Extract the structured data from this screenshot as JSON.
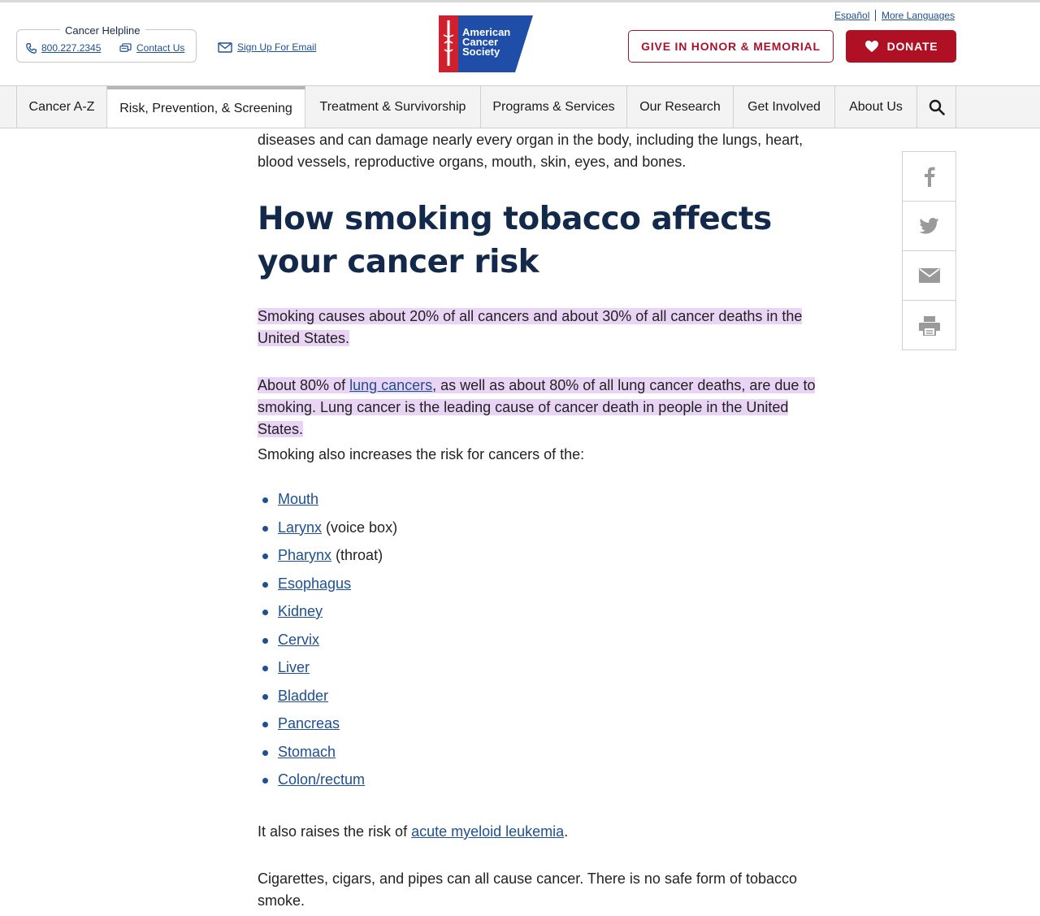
{
  "header": {
    "helpline_title": "Cancer Helpline",
    "phone": "800.227.2345",
    "contact": "Contact Us",
    "signup": "Sign Up For Email",
    "logo_lines": [
      "American",
      "Cancer",
      "Society"
    ],
    "lang_es": "Español",
    "lang_more": "More Languages",
    "honor_button": "GIVE IN HONOR & MEMORIAL",
    "donate_button": "DONATE"
  },
  "nav": {
    "items": [
      {
        "label": "Cancer A-Z"
      },
      {
        "label": "Risk, Prevention, & Screening"
      },
      {
        "label": "Treatment & Survivorship"
      },
      {
        "label": "Programs & Services"
      },
      {
        "label": "Our Research"
      },
      {
        "label": "Get Involved"
      },
      {
        "label": "About Us"
      }
    ],
    "active_index": 1
  },
  "article": {
    "intro": "diseases and can damage nearly every organ in the body, including the lungs, heart, blood vessels, reproductive organs, mouth, skin, eyes, and bones.",
    "heading": "How smoking tobacco affects your cancer risk",
    "p1": "Smoking causes about 20% of all cancers and about 30% of all cancer deaths in the United States.",
    "p2_pre": "About 80% of ",
    "p2_link": "lung cancers",
    "p2_post": ", as well as about 80% of all lung cancer deaths, are due to smoking. Lung cancer is the leading cause of cancer death in people in the United States.",
    "p3": "Smoking also increases the risk for cancers of the:",
    "list": [
      {
        "link": "Mouth",
        "suffix": ""
      },
      {
        "link": "Larynx",
        "suffix": " (voice box)"
      },
      {
        "link": "Pharynx",
        "suffix": " (throat)"
      },
      {
        "link": "Esophagus",
        "suffix": ""
      },
      {
        "link": "Kidney",
        "suffix": ""
      },
      {
        "link": "Cervix",
        "suffix": ""
      },
      {
        "link": "Liver",
        "suffix": ""
      },
      {
        "link": "Bladder",
        "suffix": ""
      },
      {
        "link": "Pancreas",
        "suffix": ""
      },
      {
        "link": "Stomach",
        "suffix": ""
      },
      {
        "link": "Colon/rectum",
        "suffix": ""
      }
    ],
    "p4_pre": "It also raises the risk of ",
    "p4_link": "acute myeloid leukemia",
    "p4_post": ".",
    "p5": "Cigarettes, cigars, and pipes can all cause cancer. There is no safe form of tobacco smoke."
  },
  "share": {
    "icons": [
      "facebook-icon",
      "twitter-icon",
      "email-icon",
      "print-icon"
    ]
  },
  "colors": {
    "brand_red": "#b01024",
    "navy": "#13294b",
    "link_blue": "#1d4f91",
    "highlight": "#ead4f5",
    "logo_blue": "#1f4ea8",
    "logo_red": "#d0202e"
  }
}
